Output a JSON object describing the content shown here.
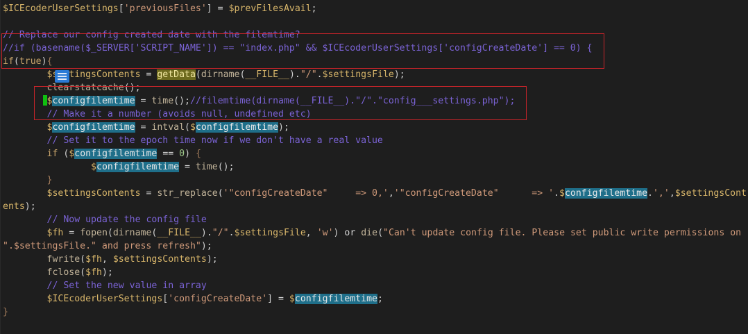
{
  "editor": {
    "language": "php",
    "lines": [
      [
        [
          "var",
          "$ICEcoderUserSettings"
        ],
        [
          "punc",
          "["
        ],
        [
          "str",
          "'previousFiles'"
        ],
        [
          "punc",
          "]"
        ],
        [
          "op",
          " = "
        ],
        [
          "var",
          "$prevFilesAvail"
        ],
        [
          "punc",
          ";"
        ]
      ],
      [],
      [
        [
          "cmt",
          "// Replace our config created date with the filemtime?"
        ]
      ],
      [
        [
          "cmt",
          "//if (basename($_SERVER['SCRIPT_NAME']) == \"index.php\" && $ICEcoderUserSettings['configCreateDate'] == 0) {"
        ]
      ],
      [
        [
          "kw",
          "if"
        ],
        [
          "punc",
          "("
        ],
        [
          "kw",
          "true"
        ],
        [
          "punc",
          ")"
        ],
        [
          "brace",
          "{"
        ]
      ],
      [
        [
          "op",
          "        "
        ],
        [
          "var",
          "$settingsContents"
        ],
        [
          "op",
          " = "
        ],
        [
          "fn",
          "getData"
        ],
        [
          "punc",
          "("
        ],
        [
          "fn",
          "dirname"
        ],
        [
          "punc",
          "("
        ],
        [
          "var",
          "__FILE__"
        ],
        [
          "punc",
          ")."
        ],
        [
          "str",
          "\"/\""
        ],
        [
          "punc",
          "."
        ],
        [
          "var",
          "$settingsFile"
        ],
        [
          "punc",
          ");"
        ]
      ],
      [
        [
          "op",
          "        "
        ],
        [
          "fn",
          "clearstatcache"
        ],
        [
          "punc",
          "();"
        ]
      ],
      [
        [
          "op",
          "        "
        ],
        [
          "var",
          "$configfilemtime"
        ],
        [
          "op",
          " = "
        ],
        [
          "fn",
          "time"
        ],
        [
          "punc",
          "();"
        ],
        [
          "cmt",
          "//filemtime(dirname(__FILE__).\"/\".\"config___settings.php\");"
        ]
      ],
      [
        [
          "op",
          "        "
        ],
        [
          "cmt",
          "// Make it a number (avoids null, undefined etc)"
        ]
      ],
      [
        [
          "op",
          "        "
        ],
        [
          "var",
          "$configfilemtime"
        ],
        [
          "op",
          " = "
        ],
        [
          "fn",
          "intval"
        ],
        [
          "punc",
          "("
        ],
        [
          "var",
          "$configfilemtime"
        ],
        [
          "punc",
          ");"
        ]
      ],
      [
        [
          "op",
          "        "
        ],
        [
          "cmt",
          "// Set it to the epoch time now if we don't have a real value"
        ]
      ],
      [
        [
          "op",
          "        "
        ],
        [
          "kw",
          "if"
        ],
        [
          "op",
          " "
        ],
        [
          "punc",
          "("
        ],
        [
          "var",
          "$configfilemtime"
        ],
        [
          "op",
          " == "
        ],
        [
          "num",
          "0"
        ],
        [
          "punc",
          ")"
        ],
        [
          "op",
          " "
        ],
        [
          "brace",
          "{"
        ]
      ],
      [
        [
          "op",
          "                "
        ],
        [
          "var",
          "$configfilemtime"
        ],
        [
          "op",
          " = "
        ],
        [
          "fn",
          "time"
        ],
        [
          "punc",
          "();"
        ]
      ],
      [
        [
          "op",
          "        "
        ],
        [
          "brace",
          "}"
        ]
      ],
      [
        [
          "op",
          "        "
        ],
        [
          "var",
          "$settingsContents"
        ],
        [
          "op",
          " = "
        ],
        [
          "fn",
          "str_replace"
        ],
        [
          "punc",
          "("
        ],
        [
          "str",
          "'\"configCreateDate\"     => 0,'"
        ],
        [
          "punc",
          ","
        ],
        [
          "str",
          "'\"configCreateDate\"      => '"
        ],
        [
          "punc",
          "."
        ],
        [
          "var",
          "$configfilemtime"
        ],
        [
          "punc",
          "."
        ],
        [
          "str",
          "','"
        ],
        [
          "punc",
          ","
        ],
        [
          "var",
          "$settingsCont"
        ]
      ],
      [
        [
          "var",
          "ents"
        ],
        [
          "punc",
          ");"
        ]
      ],
      [
        [
          "op",
          "        "
        ],
        [
          "cmt",
          "// Now update the config file"
        ]
      ],
      [
        [
          "op",
          "        "
        ],
        [
          "var",
          "$fh"
        ],
        [
          "op",
          " = "
        ],
        [
          "fn",
          "fopen"
        ],
        [
          "punc",
          "("
        ],
        [
          "fn",
          "dirname"
        ],
        [
          "punc",
          "("
        ],
        [
          "var",
          "__FILE__"
        ],
        [
          "punc",
          ")."
        ],
        [
          "str",
          "\"/\""
        ],
        [
          "punc",
          "."
        ],
        [
          "var",
          "$settingsFile"
        ],
        [
          "punc",
          ", "
        ],
        [
          "str",
          "'w'"
        ],
        [
          "punc",
          ")"
        ],
        [
          "op",
          " or "
        ],
        [
          "fn",
          "die"
        ],
        [
          "punc",
          "("
        ],
        [
          "str",
          "\"Can't update config file. Please set public write permissions on"
        ]
      ],
      [
        [
          "str",
          "\".$settingsFile.\" and press refresh\""
        ],
        [
          "punc",
          ");"
        ]
      ],
      [
        [
          "op",
          "        "
        ],
        [
          "fn",
          "fwrite"
        ],
        [
          "punc",
          "("
        ],
        [
          "var",
          "$fh"
        ],
        [
          "punc",
          ", "
        ],
        [
          "var",
          "$settingsContents"
        ],
        [
          "punc",
          ");"
        ]
      ],
      [
        [
          "op",
          "        "
        ],
        [
          "fn",
          "fclose"
        ],
        [
          "punc",
          "("
        ],
        [
          "var",
          "$fh"
        ],
        [
          "punc",
          ");"
        ]
      ],
      [
        [
          "op",
          "        "
        ],
        [
          "cmt",
          "// Set the new value in array"
        ]
      ],
      [
        [
          "op",
          "        "
        ],
        [
          "var",
          "$ICEcoderUserSettings"
        ],
        [
          "punc",
          "["
        ],
        [
          "str",
          "'configCreateDate'"
        ],
        [
          "punc",
          "]"
        ],
        [
          "op",
          " = "
        ],
        [
          "var",
          "$configfilemtime"
        ],
        [
          "punc",
          ";"
        ]
      ],
      [
        [
          "brace",
          "}"
        ]
      ]
    ],
    "highlights": {
      "selected_word": "configfilemtime",
      "matched_function": "getData"
    },
    "colors": {
      "background": "#1e1e1e",
      "annotation_box": "#c8242a",
      "change_marker": "#10c010",
      "word_highlight": "#1f6f8a",
      "function_match": "#6e6a1e"
    }
  }
}
